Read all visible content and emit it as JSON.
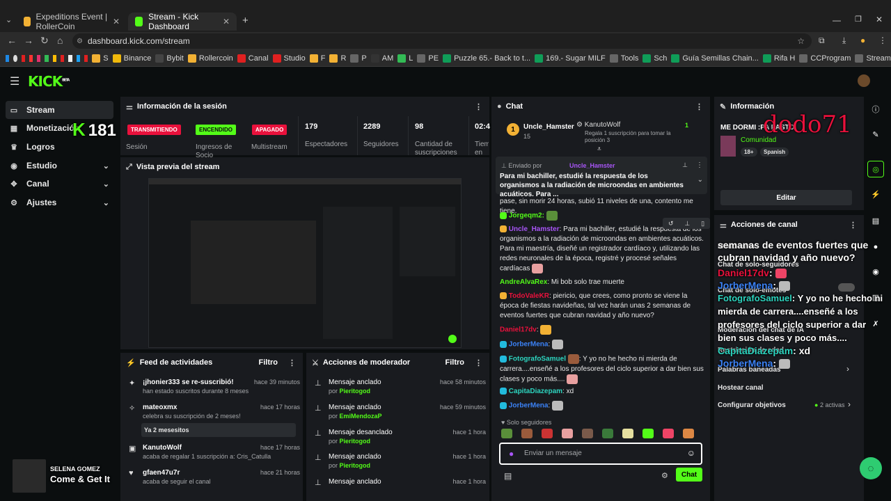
{
  "browser": {
    "tabs": [
      {
        "title": "Expeditions Event | RollerCoin"
      },
      {
        "title": "Stream - Kick Dashboard"
      }
    ],
    "url": "dashboard.kick.com/stream",
    "bookmarks": [
      "S",
      "Binance",
      "Bybit",
      "Rollercoin",
      "Canal",
      "Studio",
      "F",
      "R",
      "P",
      "AM",
      "L",
      "PE",
      "Puzzle 65.- Back to t...",
      "169.- Sugar MILF",
      "Tools",
      "Sch",
      "Guía Semillas Chain...",
      "Rifa H",
      "CCProgram",
      "Stream"
    ]
  },
  "sidebar": {
    "items": [
      {
        "label": "Stream"
      },
      {
        "label": "Monetización"
      },
      {
        "label": "Logros"
      },
      {
        "label": "Estudio"
      },
      {
        "label": "Canal"
      },
      {
        "label": "Ajustes"
      }
    ]
  },
  "session": {
    "title": "Información de la sesión",
    "status": [
      {
        "badge": "TRANSMITIENDO",
        "label": "Sesión"
      },
      {
        "badge": "ENCENDIDO",
        "label": "Ingresos de Socio"
      },
      {
        "badge": "APAGADO",
        "label": "Multistream"
      }
    ],
    "stats": [
      {
        "value": "179",
        "label": "Espectadores"
      },
      {
        "value": "2289",
        "label": "Seguidores"
      },
      {
        "value": "98",
        "label": "Cantidad de suscripciones"
      },
      {
        "value": "02:4",
        "label": "Tiem en vi"
      }
    ]
  },
  "preview": {
    "title": "Vista previa del stream"
  },
  "feed": {
    "title": "Feed de actividades",
    "filter": "Filtro",
    "items": [
      {
        "title": "¡jhonier333 se re-suscribió!",
        "sub": "han estado suscritos durante 8 meses",
        "time": "hace 39 minutos"
      },
      {
        "title": "mateoxmx",
        "sub": "celebra su suscripción de 2 meses!",
        "time": "hace 17 horas",
        "note": "Ya 2 mesesitos"
      },
      {
        "title": "KanutoWolf",
        "sub": "acaba de regalar 1 suscripción a: Cris_Catulla",
        "time": "hace 17 horas"
      },
      {
        "title": "gfaen47u7r",
        "sub": "acaba de seguir el canal",
        "time": "hace 21 horas"
      }
    ]
  },
  "modactions": {
    "title": "Acciones de moderador",
    "filter": "Filtro",
    "items": [
      {
        "title": "Mensaje anclado",
        "by": "por",
        "user": "Pieritogod",
        "time": "hace 58 minutos"
      },
      {
        "title": "Mensaje anclado",
        "by": "por",
        "user": "EmiMendozaP",
        "time": "hace 59 minutos"
      },
      {
        "title": "Mensaje desanclado",
        "by": "por",
        "user": "Pieritogod",
        "time": "hace 1 hora"
      },
      {
        "title": "Mensaje anclado",
        "by": "por",
        "user": "Pieritogod",
        "time": "hace 1 hora"
      },
      {
        "title": "Mensaje anclado",
        "by": "por",
        "user": "",
        "time": "hace 1 hora"
      }
    ]
  },
  "chat": {
    "title": "Chat",
    "top_gifter": {
      "name": "Uncle_Hamster",
      "count": "15",
      "rank": "1"
    },
    "gift": {
      "user": "KanutoWolf",
      "text": "Regala 1 suscripción para tomar la posición 3",
      "count": "1"
    },
    "pinned": {
      "label": "Enviado por",
      "user": "Uncle_Hamster",
      "text": "Para mi bachiller, estudié la respuesta de los organismos a la radiación de microondas en ambientes acuáticos. Para ..."
    },
    "messages": [
      {
        "user": "",
        "text": "pase, sin morir 24 horas, subió 11 niveles de una, contento me tiene."
      },
      {
        "user": "Jorgeqm2:",
        "text": ""
      },
      {
        "user": "Uncle_Hamster",
        "text": ": Para mi bachiller, estudié la respuesta de los organismos a la radiación de microondas en ambientes acuáticos. Para mi maestría, diseñé un registrador cardíaco y, utilizando las redes neuronales de la época, registré y procesé señales cardíacas"
      },
      {
        "user": "AndreAlvaRex",
        "text": ": Mi bob solo trae muerte"
      },
      {
        "user": "TodoValeKR",
        "text": ": piericio, que crees, como pronto se viene la época de fiestas navideñas, tal vez harán unas 2 semanas de eventos fuertes que cubran navidad y año nuevo?"
      },
      {
        "user": "Daniel17dv",
        "text": ":"
      },
      {
        "user": "JorberMena",
        "text": ":"
      },
      {
        "user": "FotografoSamuel",
        "text": ": Y yo no he hecho ni mierda de carrera....enseñé a los profesores del ciclo superior a dar bien sus clases y poco más...."
      },
      {
        "user": "CapitaDiazepam",
        "text": ": xd"
      },
      {
        "user": "JorberMena",
        "text": ":"
      }
    ],
    "mode": "Solo seguidores",
    "input_placeholder": "Enviar un mensaje",
    "send_label": "Chat"
  },
  "info": {
    "title": "Información",
    "stream_title": "ME DORMI :PA PASTO",
    "category": "Comunidad",
    "tags": [
      "18+",
      "Spanish"
    ],
    "edit_label": "Editar"
  },
  "channel_actions": {
    "title": "Acciones de canal",
    "items": [
      "Modo lento",
      "Chat de solo-seguidores",
      "Chat de solo-emotes",
      "Moderación del chat de IA",
      "Restricción de edad",
      "Palabras baneadas",
      "Hostear canal"
    ],
    "goals_label": "Configurar objetivos",
    "goals_active": "2 activas"
  },
  "overlays": {
    "viewer_count": "181",
    "streamer": "dodo71",
    "song_artist": "SELENA GOMEZ",
    "song_title": "Come & Get It",
    "big_chat": [
      {
        "text": "semanas de eventos fuertes que"
      },
      {
        "text": "cubran navidad y año nuevo?"
      },
      {
        "user": "Daniel17dv",
        "text": ":"
      },
      {
        "user": "JorberMena",
        "text": ":"
      },
      {
        "user": "FotografoSamuel",
        "text": ": Y yo no he hecho ni mierda de carrera....enseñé a los profesores del ciclo superior a dar bien sus clases y poco más...."
      },
      {
        "user": "CapitaDiazepam",
        "text": ": xd"
      },
      {
        "user": "JorberMena",
        "text": ":"
      }
    ]
  },
  "colors": {
    "accent": "#53fc18",
    "live_red": "#e9113c",
    "panel": "#191b1f",
    "bg": "#0b0e0f"
  }
}
